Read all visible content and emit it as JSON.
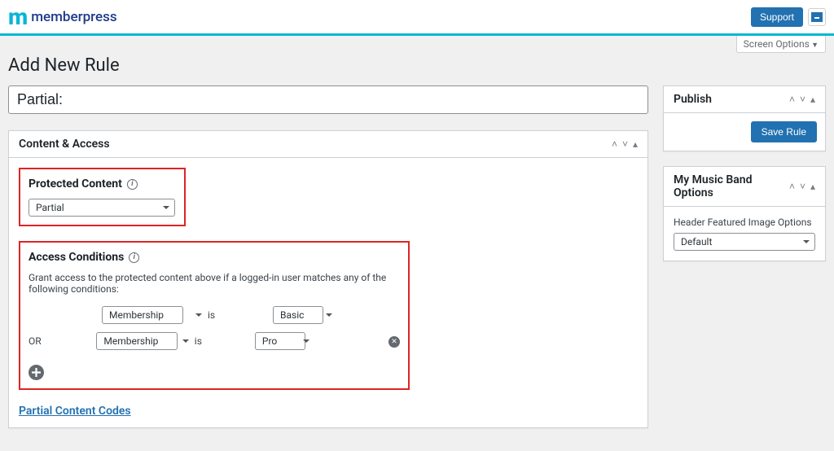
{
  "brand": {
    "logo": "m",
    "name": "memberpress"
  },
  "topbar": {
    "support": "Support"
  },
  "screen_options": "Screen Options",
  "page_title": "Add New Rule",
  "title_value": "Partial:",
  "content_access": {
    "header": "Content & Access",
    "protected": {
      "title": "Protected Content",
      "value": "Partial"
    },
    "access": {
      "title": "Access Conditions",
      "desc": "Grant access to the protected content above if a logged-in user matches any of the following conditions:",
      "is_label": "is",
      "or_label": "OR",
      "rows": [
        {
          "type": "Membership",
          "value": "Basic"
        },
        {
          "type": "Membership",
          "value": "Pro"
        }
      ]
    },
    "partial_link": "Partial Content Codes"
  },
  "publish": {
    "header": "Publish",
    "button": "Save Rule"
  },
  "music_box": {
    "header": "My Music Band Options",
    "label": "Header Featured Image Options",
    "value": "Default"
  }
}
